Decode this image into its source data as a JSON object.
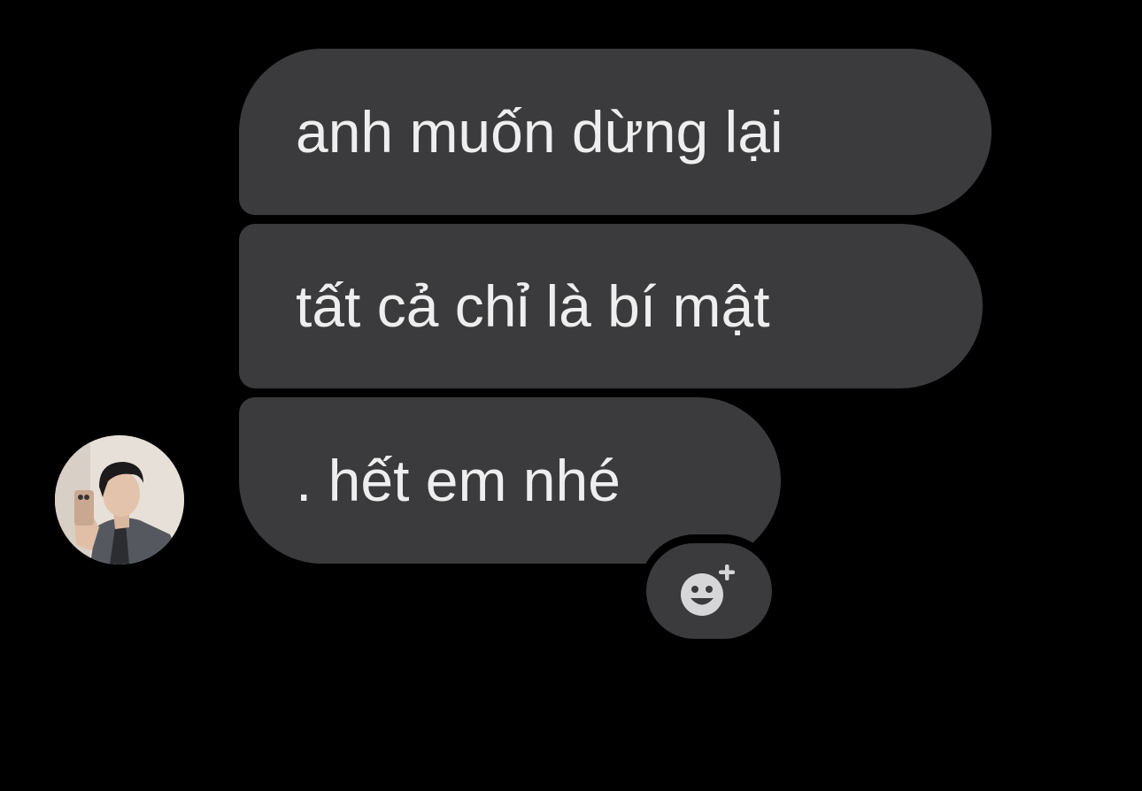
{
  "conversation": {
    "messages": [
      {
        "text": "anh muốn dừng lại"
      },
      {
        "text": "tất cả chỉ là bí mật"
      },
      {
        "text": ". hết em nhé"
      }
    ],
    "sender_avatar": "avatar-photo",
    "reaction_button_icon": "add-reaction-smiley-icon"
  },
  "colors": {
    "background": "#000000",
    "bubble": "#3b3b3d",
    "bubble_text": "#eeeeee",
    "icon": "#d6d6d8"
  }
}
